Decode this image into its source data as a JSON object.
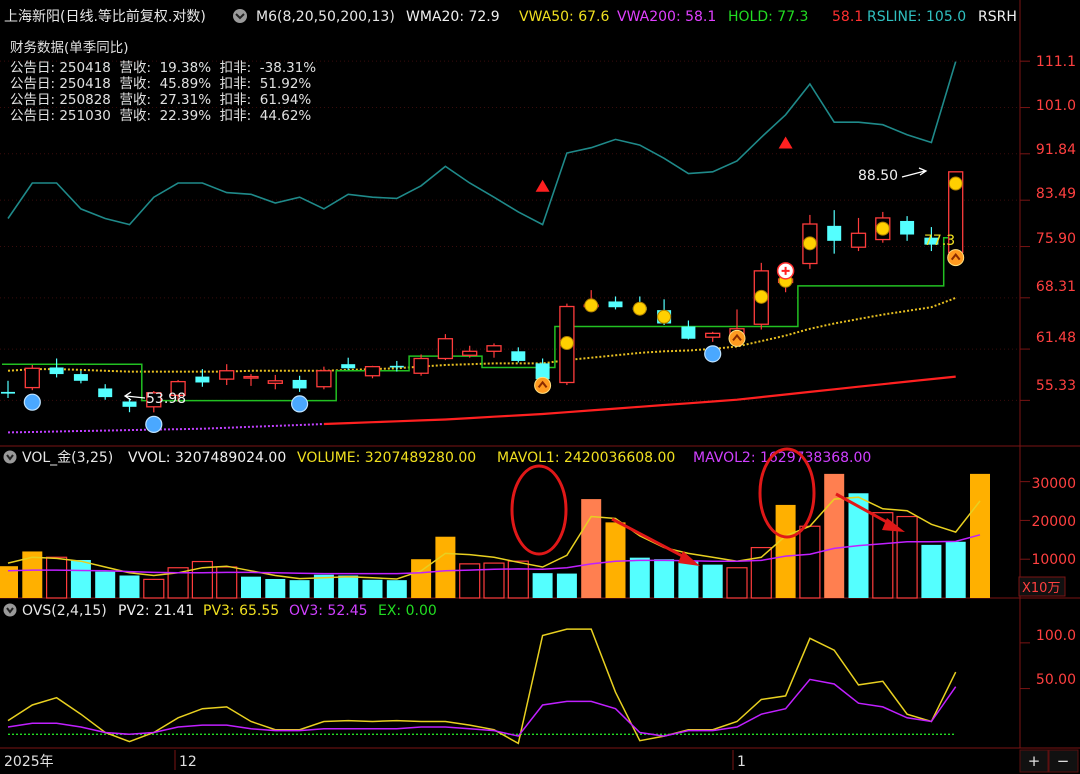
{
  "header": {
    "title": "上海新阳(日线.等比前复权.对数)",
    "indicator": "M6(8,20,50,200,13)",
    "wma20": "WMA20: 72.9",
    "vwa50": "VWA50: 67.6",
    "vwa200": "VWA200: 58.1",
    "hold": "HOLD: 77.3",
    "hold2": "58.1",
    "rsline": "RSLINE: 105.0",
    "rsrh": "RSRH"
  },
  "finance": {
    "title": "财务数据(单季同比)",
    "rows": [
      "公告日: 250418  营收:  19.38%  扣非:  -38.31%",
      "公告日: 250418  营收:  45.89%  扣非:  51.92%",
      "公告日: 250828  营收:  27.31%  扣非:  61.94%",
      "公告日: 251030  营收:  22.39%  扣非:  44.62%"
    ]
  },
  "price_axis": [
    "111.1",
    "101.0",
    "91.84",
    "83.49",
    "75.90",
    "68.31",
    "61.48",
    "55.33"
  ],
  "annotations": {
    "high": "88.50",
    "low": "53.98",
    "last": "77.3"
  },
  "vol_header": {
    "name": "VOL_金(3,25)",
    "vvol": "VVOL: 3207489024.00",
    "volume": "VOLUME: 3207489280.00",
    "mavol1": "MAVOL1: 2420036608.00",
    "mavol2": "MAVOL2: 1629738368.00"
  },
  "vol_axis": [
    "30000",
    "20000",
    "10000"
  ],
  "vol_unit": "X10万",
  "ovs_header": {
    "name": "OVS(2,4,15)",
    "pv2": "PV2: 21.41",
    "pv3": "PV3: 65.55",
    "ov3": "OV3: 52.45",
    "ex": "EX: 0.00"
  },
  "ovs_axis": [
    "100.0",
    "50.00"
  ],
  "time_axis": [
    "2025年",
    "12",
    "1"
  ],
  "buttons": {
    "plus": "+",
    "minus": "−"
  },
  "colors": {
    "up": "#ff3c3c",
    "down": "#54ffff",
    "gold": "#ffff00",
    "orange_bar": "#ffb000",
    "rsline": "#1f8a8a",
    "hold": "#22c022",
    "vwa200": "#ff2020",
    "mavol2": "#c020ff",
    "salmon": "#ff7f50"
  },
  "chart_data": {
    "type": "candlestick",
    "price_scale": "log",
    "ylim": [
      51,
      117
    ],
    "candles": [
      {
        "o": 56.3,
        "h": 57.6,
        "l": 55.6,
        "c": 56.1
      },
      {
        "o": 56.8,
        "h": 59.5,
        "l": 56.5,
        "c": 59.1
      },
      {
        "o": 59.2,
        "h": 60.3,
        "l": 58.0,
        "c": 58.4
      },
      {
        "o": 58.4,
        "h": 58.8,
        "l": 57.3,
        "c": 57.6
      },
      {
        "o": 56.7,
        "h": 57.2,
        "l": 55.4,
        "c": 55.7
      },
      {
        "o": 55.2,
        "h": 55.6,
        "l": 54.0,
        "c": 54.6
      },
      {
        "o": 54.6,
        "h": 56.4,
        "l": 53.98,
        "c": 56.2
      },
      {
        "o": 55.9,
        "h": 57.7,
        "l": 55.2,
        "c": 57.5
      },
      {
        "o": 58.1,
        "h": 59.0,
        "l": 56.9,
        "c": 57.4
      },
      {
        "o": 57.8,
        "h": 59.6,
        "l": 57.1,
        "c": 58.8
      },
      {
        "o": 58.0,
        "h": 58.4,
        "l": 57.0,
        "c": 58.1
      },
      {
        "o": 57.3,
        "h": 58.3,
        "l": 56.6,
        "c": 57.6
      },
      {
        "o": 57.7,
        "h": 58.2,
        "l": 56.3,
        "c": 56.7
      },
      {
        "o": 56.9,
        "h": 59.3,
        "l": 56.6,
        "c": 58.8
      },
      {
        "o": 59.6,
        "h": 60.4,
        "l": 58.9,
        "c": 59.1
      },
      {
        "o": 58.2,
        "h": 59.4,
        "l": 57.9,
        "c": 59.3
      },
      {
        "o": 59.4,
        "h": 60.0,
        "l": 58.7,
        "c": 59.2
      },
      {
        "o": 58.5,
        "h": 60.8,
        "l": 58.2,
        "c": 60.3
      },
      {
        "o": 60.3,
        "h": 63.4,
        "l": 60.1,
        "c": 62.8
      },
      {
        "o": 60.7,
        "h": 61.9,
        "l": 60.4,
        "c": 61.2
      },
      {
        "o": 61.2,
        "h": 62.2,
        "l": 60.4,
        "c": 61.9
      },
      {
        "o": 61.2,
        "h": 61.7,
        "l": 59.8,
        "c": 60.0
      },
      {
        "o": 59.7,
        "h": 60.3,
        "l": 57.3,
        "c": 57.8
      },
      {
        "o": 57.4,
        "h": 67.5,
        "l": 57.1,
        "c": 67.1
      },
      {
        "o": 67.2,
        "h": 69.4,
        "l": 66.4,
        "c": 67.3
      },
      {
        "o": 67.8,
        "h": 68.5,
        "l": 66.7,
        "c": 67.0
      },
      {
        "o": 67.0,
        "h": 68.5,
        "l": 66.0,
        "c": 66.6
      },
      {
        "o": 66.6,
        "h": 68.1,
        "l": 64.6,
        "c": 64.8
      },
      {
        "o": 64.4,
        "h": 65.2,
        "l": 62.7,
        "c": 62.8
      },
      {
        "o": 63.0,
        "h": 63.7,
        "l": 62.4,
        "c": 63.5
      },
      {
        "o": 63.3,
        "h": 66.7,
        "l": 63.1,
        "c": 64.1
      },
      {
        "o": 64.7,
        "h": 73.4,
        "l": 64.0,
        "c": 72.2
      },
      {
        "o": 70.5,
        "h": 71.9,
        "l": 69.1,
        "c": 71.0
      },
      {
        "o": 73.3,
        "h": 81.0,
        "l": 72.5,
        "c": 79.5
      },
      {
        "o": 79.2,
        "h": 81.8,
        "l": 74.8,
        "c": 76.8
      },
      {
        "o": 75.8,
        "h": 80.5,
        "l": 75.2,
        "c": 78.0
      },
      {
        "o": 77.0,
        "h": 81.5,
        "l": 76.5,
        "c": 80.5
      },
      {
        "o": 80.0,
        "h": 80.8,
        "l": 76.8,
        "c": 77.8
      },
      {
        "o": 77.3,
        "h": 79.0,
        "l": 75.2,
        "c": 76.2
      },
      {
        "o": 75.0,
        "h": 88.5,
        "l": 74.5,
        "c": 88.5
      }
    ],
    "rsline": [
      80.4,
      86.5,
      86.5,
      82.0,
      80.4,
      79.4,
      84.0,
      86.5,
      86.5,
      84.8,
      84.5,
      83.0,
      84.0,
      82.0,
      84.5,
      84.0,
      83.8,
      86.0,
      89.5,
      86.5,
      84.0,
      81.5,
      79.4,
      92.0,
      93.0,
      94.6,
      93.5,
      91.0,
      88.2,
      88.5,
      90.5,
      95.0,
      99.5,
      106.0,
      98.0,
      98.0,
      97.5,
      95.5,
      94.0,
      111.0
    ],
    "wma20": [
      58.8,
      59.0,
      59.0,
      58.9,
      58.8,
      58.7,
      58.7,
      58.7,
      58.7,
      58.7,
      58.8,
      58.8,
      58.8,
      58.8,
      58.9,
      59.0,
      59.1,
      59.3,
      59.5,
      59.6,
      59.7,
      59.7,
      59.7,
      60.1,
      60.4,
      60.7,
      61.0,
      61.2,
      61.3,
      61.5,
      61.8,
      62.5,
      63.2,
      64.1,
      64.8,
      65.4,
      66.0,
      66.5,
      67.0,
      68.3
    ],
    "hold": [
      59.6,
      59.6,
      59.6,
      59.6,
      59.6,
      59.6,
      55.3,
      55.3,
      55.3,
      55.3,
      55.3,
      55.3,
      55.3,
      55.3,
      58.8,
      58.8,
      58.8,
      60.6,
      60.6,
      60.6,
      59.2,
      59.2,
      59.2,
      64.4,
      64.4,
      64.4,
      64.4,
      64.4,
      64.4,
      64.4,
      64.4,
      64.4,
      64.4,
      70.0,
      70.0,
      70.0,
      70.0,
      70.0,
      70.0,
      77.3
    ],
    "vwa200": [
      51.8,
      51.85,
      51.9,
      51.95,
      52.0,
      52.05,
      52.1,
      52.15,
      52.2,
      52.3,
      52.4,
      52.5,
      52.6,
      52.7,
      52.8,
      52.9,
      53.0,
      53.1,
      53.2,
      53.35,
      53.5,
      53.65,
      53.8,
      54.0,
      54.2,
      54.4,
      54.6,
      54.8,
      55.0,
      55.2,
      55.4,
      55.7,
      56.0,
      56.3,
      56.6,
      56.9,
      57.2,
      57.5,
      57.8,
      58.1
    ],
    "vwa200_dotted_until": 13,
    "vol_ylim": [
      0,
      33000
    ],
    "volume": [
      8200,
      12000,
      10500,
      9800,
      6800,
      5800,
      4800,
      7800,
      9400,
      8000,
      5500,
      4900,
      4600,
      6000,
      5800,
      4700,
      4600,
      10000,
      15800,
      8800,
      9000,
      9500,
      6400,
      6300,
      25500,
      19500,
      10400,
      10000,
      9400,
      8600,
      7800,
      13000,
      24000,
      18500,
      32000,
      27000,
      22000,
      21000,
      13700,
      14500,
      32000
    ],
    "vol_up": [
      false,
      false,
      true,
      false,
      false,
      false,
      true,
      true,
      true,
      true,
      false,
      false,
      false,
      false,
      false,
      false,
      false,
      false,
      false,
      true,
      true,
      true,
      false,
      false,
      true,
      false,
      false,
      false,
      false,
      false,
      true,
      true,
      false,
      true,
      true,
      false,
      true,
      true,
      false,
      false,
      true
    ],
    "vol_style": [
      "gold",
      "gold",
      "hollow",
      "cyan",
      "cyan",
      "cyan",
      "hollow",
      "hollow",
      "hollow",
      "hollow",
      "cyan",
      "cyan",
      "cyan",
      "cyan",
      "cyan",
      "cyan",
      "cyan",
      "gold",
      "gold",
      "hollow",
      "hollow",
      "hollow",
      "cyan",
      "cyan",
      "salmon",
      "gold",
      "cyan",
      "cyan",
      "cyan",
      "cyan",
      "hollow",
      "hollow",
      "gold",
      "hollow",
      "salmon",
      "cyan",
      "hollow",
      "hollow",
      "cyan",
      "cyan",
      "gold"
    ],
    "mavol1": [
      9000,
      10500,
      10200,
      9500,
      8000,
      6500,
      5800,
      6500,
      7800,
      8200,
      7000,
      5800,
      5000,
      5200,
      5500,
      5200,
      4900,
      7000,
      11500,
      11200,
      10500,
      9200,
      8000,
      11000,
      21000,
      20500,
      16000,
      13000,
      11500,
      10500,
      9500,
      10500,
      16000,
      18500,
      25500,
      26000,
      23000,
      22500,
      19000,
      17000,
      25000
    ],
    "mavol2": [
      7000,
      7200,
      7200,
      7100,
      7000,
      6800,
      6600,
      6500,
      6500,
      6600,
      6600,
      6500,
      6400,
      6300,
      6300,
      6300,
      6300,
      6500,
      7000,
      7200,
      7400,
      7500,
      7400,
      7800,
      8800,
      9500,
      9700,
      9700,
      9600,
      9500,
      9500,
      9700,
      10800,
      11300,
      12800,
      13500,
      14000,
      14500,
      14500,
      14600,
      16300
    ],
    "ovs_ylim": [
      -15,
      125
    ],
    "pv3": [
      15,
      32,
      40,
      22,
      2,
      -8,
      2,
      18,
      28,
      30,
      14,
      5,
      5,
      14,
      15,
      14,
      15,
      14,
      14,
      10,
      5,
      -10,
      108,
      115,
      115,
      46,
      -7,
      -2,
      5,
      5,
      14,
      38,
      42,
      105,
      92,
      54,
      58,
      22,
      14,
      68
    ],
    "ov3": [
      8,
      12,
      12,
      8,
      2,
      0,
      2,
      8,
      10,
      10,
      6,
      4,
      4,
      6,
      6,
      6,
      6,
      8,
      8,
      6,
      4,
      -2,
      32,
      36,
      36,
      28,
      2,
      -2,
      4,
      4,
      8,
      22,
      28,
      60,
      55,
      34,
      30,
      18,
      14,
      52
    ],
    "ex": 0
  }
}
